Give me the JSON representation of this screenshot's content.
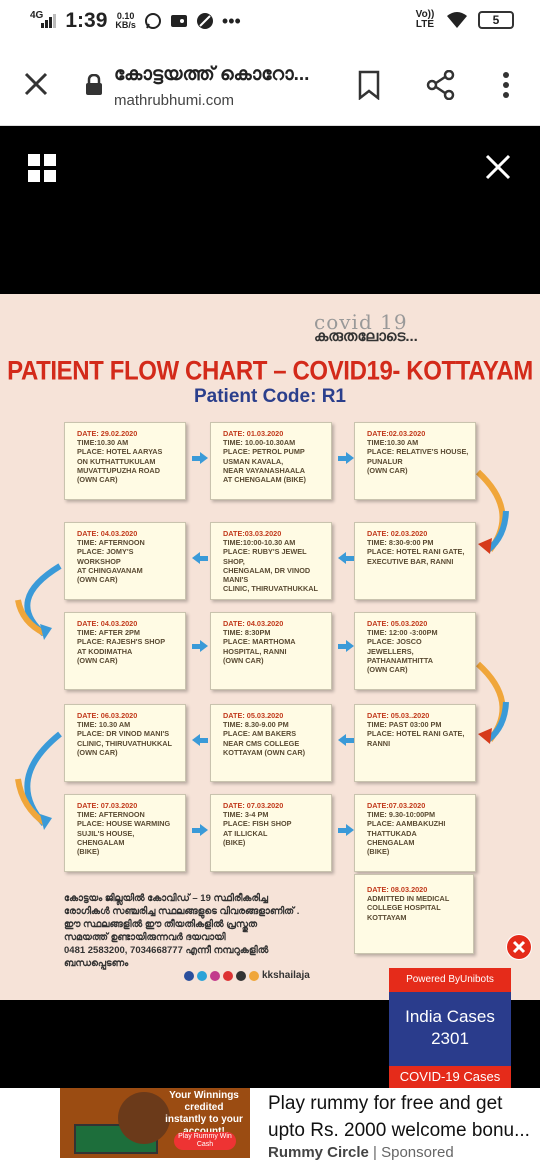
{
  "status_bar": {
    "network": "4G",
    "time": "1:39",
    "speed_value": "0.10",
    "speed_unit": "KB/s",
    "volte": "Vo)) LTE",
    "battery": "5"
  },
  "browser": {
    "page_title": "കോട്ടയത്ത് കൊറോ...",
    "domain": "mathrubhumi.com"
  },
  "poster": {
    "brand_top": "covid 19",
    "brand_bottom": "കരുതലോടെ...",
    "title": "PATIENT FLOW CHART – COVID19- KOTTAYAM",
    "subtitle": "Patient Code: R1",
    "cards": [
      {
        "date": "DATE: 29.02.2020",
        "lines": [
          "TIME:10.30 AM",
          "PLACE: HOTEL AARYAS",
          "ON KUTHATTUKULAM",
          "MUVATTUPUZHA ROAD",
          "(OWN CAR)"
        ]
      },
      {
        "date": "DATE: 01.03.2020",
        "lines": [
          "TIME: 10.00-10.30AM",
          "PLACE: PETROL PUMP",
          "USMAN KAVALA,",
          "NEAR VAYANASHAALA",
          "AT CHENGALAM (BIKE)"
        ]
      },
      {
        "date": "DATE:02.03.2020",
        "lines": [
          "TIME:10.30 AM",
          "PLACE: RELATIVE'S HOUSE,",
          "PUNALUR",
          "(OWN CAR)"
        ]
      },
      {
        "date": "DATE: 04.03.2020",
        "lines": [
          "TIME: AFTERNOON",
          "PLACE: JOMY'S WORKSHOP",
          "AT CHINGAVANAM",
          "(OWN CAR)"
        ]
      },
      {
        "date": "DATE:03.03.2020",
        "lines": [
          "TIME:10:00-10.30 AM",
          "PLACE: RUBY'S JEWEL SHOP,",
          "CHENGALAM, Dr VINOD MANI'S",
          "CLINIC, THIRUVATHUKKAL"
        ]
      },
      {
        "date": "DATE: 02.03.2020",
        "lines": [
          "TIME: 8:30-9:00 PM",
          "PLACE: HOTEL RANI GATE,",
          "EXECUTIVE BAR, RANNI"
        ]
      },
      {
        "date": "DATE: 04.03.2020",
        "lines": [
          "TIME: AFTER 2PM",
          "PLACE: RAJESH'S SHOP",
          "AT KODIMATHA",
          "(OWN CAR)"
        ]
      },
      {
        "date": "DATE: 04.03.2020",
        "lines": [
          "TIME: 8:30PM",
          "PLACE: MARTHOMA",
          "HOSPITAL, RANNI",
          "(OWN CAR)"
        ]
      },
      {
        "date": "DATE: 05.03.2020",
        "lines": [
          "TIME: 12:00 -3:00PM",
          "PLACE: JOSCO JEWELLERS,",
          "PATHANAMTHITTA",
          "(OWN CAR)"
        ]
      },
      {
        "date": "DATE: 06.03.2020",
        "lines": [
          "TIME: 10.30 AM",
          "PLACE: Dr VINOD MANI'S",
          "CLINIC, THIRUVATHUKKAL",
          "(OWN CAR)"
        ]
      },
      {
        "date": "DATE: 05.03.2020",
        "lines": [
          "TIME: 8.30-9.00 PM",
          "PLACE: AM BAKERS",
          "NEAR CMS COLLEGE",
          "KOTTAYAM (OWN CAR)"
        ]
      },
      {
        "date": "DATE: 05.03..2020",
        "lines": [
          "TIME: PAST 03:00 PM",
          "PLACE: HOTEL RANI GATE,",
          "RANNI"
        ]
      },
      {
        "date": "DATE: 07.03.2020",
        "lines": [
          "TIME: AFTERNOON",
          "PLACE: HOUSE WARMING",
          "SUJIL'S HOUSE,",
          "CHENGALAM",
          "(BIKE)"
        ]
      },
      {
        "date": "DATE: 07.03.2020",
        "lines": [
          "TIME: 3-4 PM",
          "PLACE: FISH SHOP",
          "AT ILLICKAL",
          "(BIKE)"
        ]
      },
      {
        "date": "DATE:07.03.2020",
        "lines": [
          "TIME:  9.30-10:00PM",
          "PLACE: AAMBAKUZHI",
          "THATTUKADA",
          "CHENGALAM",
          "(BIKE)"
        ]
      },
      {
        "date": "DATE: 08.03.2020",
        "lines": [
          "ADMITTED IN  MEDICAL",
          "COLLEGE HOSPITAL",
          "KOTTAYAM"
        ]
      }
    ],
    "footer_lines": [
      "കോട്ടയം ജില്ലയിൽ കോവിഡ് – 19 സ്ഥിരീകരിച്ച",
      "രോഗികൾ സഞ്ചരിച്ച സ്ഥലങ്ങളുടെ വിവരങ്ങളാണിത് .",
      "ഈ സ്ഥലങ്ങളിൽ ഈ തീയതികളിൽ പ്രസ്തുത",
      "സമയത്ത് ഉണ്ടായിരുന്നവർ ദയവായി",
      "0481 2583200, 7034668777 എന്നീ നമ്പറുകളിൽ",
      "ബന്ധപ്പെടണം"
    ],
    "social_handle": "kkshailaja"
  },
  "widget": {
    "powered_by": "Powered ByUnibots",
    "label": "India Cases",
    "count": "2301",
    "footer": "COVID-19 Cases"
  },
  "ad": {
    "thumb_text": "Your Winnings credited instantly to your account!",
    "thumb_button": "Play Rummy Win Cash",
    "headline": "Play rummy for free and get upto Rs. 2000 welcome bonu...",
    "advertiser": "Rummy Circle",
    "sponsored": "Sponsored"
  },
  "colors": {
    "poster_bg": "#f6e3d8",
    "title_red": "#d32a1a",
    "subtitle_blue": "#2b3f8c",
    "arrow_blue": "#3a9ad8",
    "arrow_orange": "#f0a63a",
    "arrow_red": "#d63a1a"
  }
}
